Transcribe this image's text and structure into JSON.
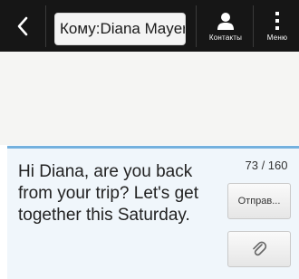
{
  "header": {
    "back_icon": "chevron-left-icon",
    "recipient": "Кому:Diana Mayer",
    "contacts_icon": "person-icon",
    "contacts_label": "Контакты",
    "menu_icon": "vertical-dots-icon",
    "menu_label": "Меню",
    "bar_color": "#161616"
  },
  "compose": {
    "message": "Hi Diana, are you back from your trip? Let's get together this Saturday.",
    "char_count": "73 / 160",
    "send_label": "Отправ...",
    "attach_icon": "paperclip-icon",
    "accent_color": "#74b1de"
  }
}
